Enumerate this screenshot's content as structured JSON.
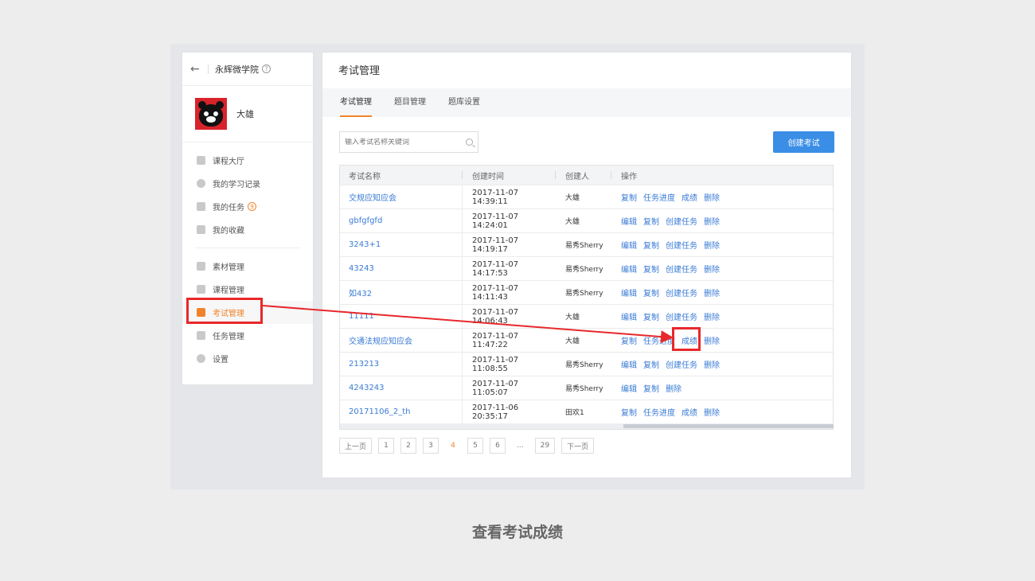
{
  "sidebar": {
    "app_title": "永辉微学院",
    "help_label": "?",
    "user_name": "大雄",
    "nav_group1": [
      {
        "label": "课程大厅",
        "icon": "bank-icon"
      },
      {
        "label": "我的学习记录",
        "icon": "clock-icon"
      },
      {
        "label": "我的任务",
        "icon": "task-check-icon",
        "badge": "9"
      },
      {
        "label": "我的收藏",
        "icon": "folder-icon"
      }
    ],
    "nav_group2": [
      {
        "label": "素材管理",
        "icon": "media-icon"
      },
      {
        "label": "课程管理",
        "icon": "course-icon"
      },
      {
        "label": "考试管理",
        "icon": "exam-icon",
        "active": true
      },
      {
        "label": "任务管理",
        "icon": "task-icon"
      },
      {
        "label": "设置",
        "icon": "gear-icon"
      }
    ]
  },
  "main": {
    "title": "考试管理",
    "tabs": [
      "考试管理",
      "题目管理",
      "题库设置"
    ],
    "search_placeholder": "输入考试名称关键词",
    "create_label": "创建考试",
    "columns": [
      "考试名称",
      "创建时间",
      "创建人",
      "操作"
    ],
    "rows": [
      {
        "name": "交规应知应会",
        "time": "2017-11-07 14:39:11",
        "creator": "大雄",
        "ops": [
          "复制",
          "任务进度",
          "成绩",
          "删除"
        ]
      },
      {
        "name": "gbfgfgfd",
        "time": "2017-11-07 14:24:01",
        "creator": "大雄",
        "ops": [
          "编辑",
          "复制",
          "创建任务",
          "删除"
        ]
      },
      {
        "name": "3243+1",
        "time": "2017-11-07 14:19:17",
        "creator": "易秀Sherry",
        "ops": [
          "编辑",
          "复制",
          "创建任务",
          "删除"
        ]
      },
      {
        "name": "43243",
        "time": "2017-11-07 14:17:53",
        "creator": "易秀Sherry",
        "ops": [
          "编辑",
          "复制",
          "创建任务",
          "删除"
        ]
      },
      {
        "name": "如432",
        "time": "2017-11-07 14:11:43",
        "creator": "易秀Sherry",
        "ops": [
          "编辑",
          "复制",
          "创建任务",
          "删除"
        ]
      },
      {
        "name": "11111",
        "time": "2017-11-07 14:06:43",
        "creator": "大雄",
        "ops": [
          "编辑",
          "复制",
          "创建任务",
          "删除"
        ]
      },
      {
        "name": "交通法规应知应会",
        "time": "2017-11-07 11:47:22",
        "creator": "大雄",
        "ops": [
          "复制",
          "任务进度",
          "成绩",
          "删除"
        ]
      },
      {
        "name": "213213",
        "time": "2017-11-07 11:08:55",
        "creator": "易秀Sherry",
        "ops": [
          "编辑",
          "复制",
          "创建任务",
          "删除"
        ]
      },
      {
        "name": "4243243",
        "time": "2017-11-07 11:05:07",
        "creator": "易秀Sherry",
        "ops": [
          "编辑",
          "复制",
          "删除"
        ]
      },
      {
        "name": "20171106_2_th",
        "time": "2017-11-06 20:35:17",
        "creator": "田欢1",
        "ops": [
          "复制",
          "任务进度",
          "成绩",
          "删除"
        ]
      }
    ],
    "pager": {
      "prev": "上一页",
      "pages": [
        "1",
        "2",
        "3",
        "4",
        "5",
        "6"
      ],
      "current": "4",
      "dots": "...",
      "last": "29",
      "next": "下一页"
    }
  },
  "caption": "查看考试成绩",
  "colors": {
    "accent": "#f0832a",
    "primary": "#3a8ee6",
    "link": "#3a7bd5",
    "annotation": "#e8282b"
  }
}
